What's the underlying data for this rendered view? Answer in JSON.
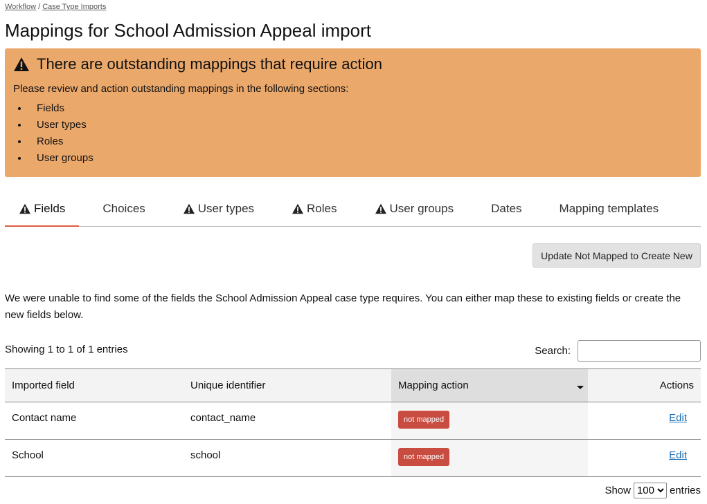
{
  "breadcrumb": {
    "items": [
      "Workflow",
      "Case Type Imports"
    ],
    "separator": "/"
  },
  "title": "Mappings for School Admission Appeal import",
  "alert": {
    "heading": "There are outstanding mappings that require action",
    "text": "Please review and action outstanding mappings in the following sections:",
    "items": [
      "Fields",
      "User types",
      "Roles",
      "User groups"
    ],
    "color": "#eba86b"
  },
  "tabs": [
    {
      "label": "Fields",
      "warning": true,
      "active": true
    },
    {
      "label": "Choices",
      "warning": false
    },
    {
      "label": "User types",
      "warning": true
    },
    {
      "label": "Roles",
      "warning": true
    },
    {
      "label": "User groups",
      "warning": true
    },
    {
      "label": "Dates",
      "warning": false
    },
    {
      "label": "Mapping templates",
      "warning": false
    }
  ],
  "update_button": "Update Not Mapped to Create New",
  "description": "We were unable to find some of the fields the School Admission Appeal case type requires. You can either map these to existing fields or create the new fields below.",
  "info": "Showing 1 to 1 of 1 entries",
  "search": {
    "label": "Search:",
    "value": ""
  },
  "table": {
    "headers": [
      "Imported field",
      "Unique identifier",
      "Mapping action",
      "Actions"
    ],
    "rows": [
      {
        "field": "Contact name",
        "id": "contact_name",
        "action": "not mapped",
        "edit": "Edit"
      },
      {
        "field": "School",
        "id": "school",
        "action": "not mapped",
        "edit": "Edit"
      }
    ]
  },
  "length": {
    "show": "Show",
    "value": "100",
    "entries": "entries"
  },
  "badge_color": "#c94c40"
}
